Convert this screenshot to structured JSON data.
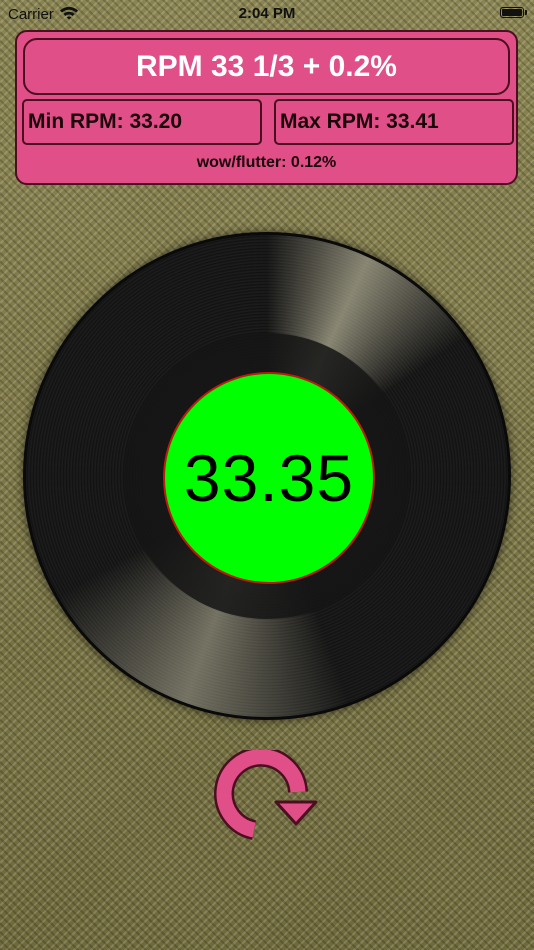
{
  "status_bar": {
    "carrier": "Carrier",
    "time": "2:04 PM",
    "wifi_icon": "wifi-icon",
    "battery_icon": "battery-icon"
  },
  "panel": {
    "title": "RPM 33 1/3 + 0.2%",
    "min_rpm": "Min RPM: 33.20",
    "max_rpm": "Max RPM: 33.41",
    "flutter": "wow/flutter: 0.12%"
  },
  "record": {
    "current_rpm": "33.35"
  },
  "reset": {
    "icon": "reset-rotate-icon"
  },
  "colors": {
    "panel": "#e04f87",
    "panel_border": "#4a1020",
    "label_disc": "#00ff00",
    "label_ring": "#c01a10",
    "reset_icon": "#e04f87"
  }
}
